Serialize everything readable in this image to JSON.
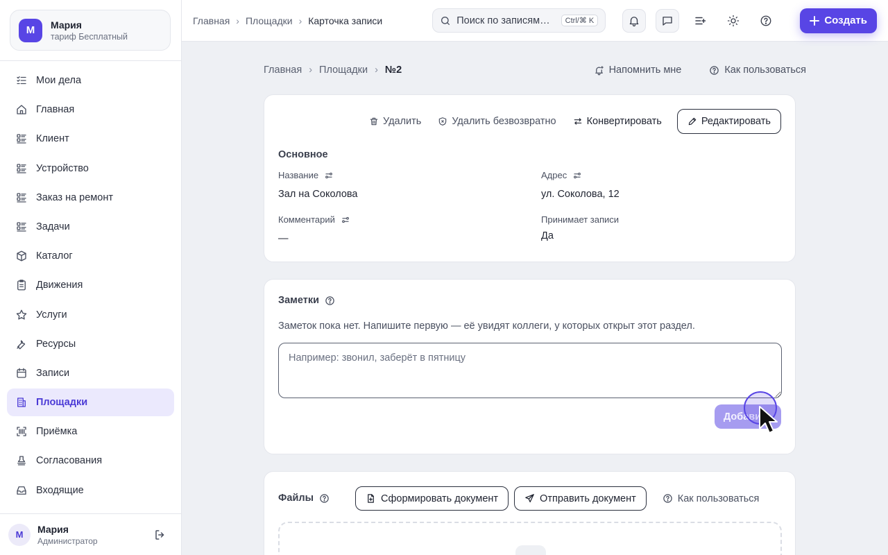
{
  "user": {
    "initial": "М",
    "name": "Мария",
    "plan": "тариф Бесплатный",
    "role": "Администратор"
  },
  "sidebar": {
    "items": [
      {
        "label": "Мои дела",
        "icon": "checklist-icon"
      },
      {
        "label": "Главная",
        "icon": "home-icon"
      },
      {
        "label": "Клиент",
        "icon": "list-icon"
      },
      {
        "label": "Устройство",
        "icon": "list-icon"
      },
      {
        "label": "Заказ на ремонт",
        "icon": "list-icon"
      },
      {
        "label": "Задачи",
        "icon": "list-icon"
      },
      {
        "label": "Каталог",
        "icon": "box-icon"
      },
      {
        "label": "Движения",
        "icon": "clipboard-icon"
      },
      {
        "label": "Услуги",
        "icon": "star-icon"
      },
      {
        "label": "Ресурсы",
        "icon": "wrench-icon"
      },
      {
        "label": "Записи",
        "icon": "calendar-icon"
      },
      {
        "label": "Площадки",
        "icon": "building-icon"
      },
      {
        "label": "Приёмка",
        "icon": "scan-icon"
      },
      {
        "label": "Согласования",
        "icon": "stamp-icon"
      },
      {
        "label": "Входящие",
        "icon": "inbox-icon"
      }
    ],
    "active_index": 11
  },
  "topbar": {
    "breadcrumbs": [
      "Главная",
      "Площадки",
      "Карточка записи"
    ],
    "search_placeholder": "Поиск по записям",
    "search_display": "Поиск по записям…",
    "shortcut": "Ctrl/⌘ K",
    "create_label": "Создать"
  },
  "page": {
    "breadcrumbs": [
      "Главная",
      "Площадки",
      "№2"
    ],
    "remind_label": "Напомнить мне",
    "howto_label": "Как пользоваться"
  },
  "record": {
    "actions": {
      "delete": "Удалить",
      "delete_forever": "Удалить безвозвратно",
      "convert": "Конвертировать",
      "edit": "Редактировать"
    },
    "section_title": "Основное",
    "fields": {
      "name": {
        "label": "Название",
        "value": "Зал на Соколова"
      },
      "address": {
        "label": "Адрес",
        "value": "ул. Соколова, 12"
      },
      "comment": {
        "label": "Комментарий",
        "value": "—"
      },
      "accepts": {
        "label": "Принимает записи",
        "value": "Да"
      }
    }
  },
  "notes": {
    "title": "Заметки",
    "empty_text": "Заметок пока нет. Напишите первую — её увидят коллеги, у которых открыт этот раздел.",
    "placeholder": "Например: звонил, заберёт в пятницу",
    "add_label": "Добавить"
  },
  "files": {
    "title": "Файлы",
    "generate_label": "Сформировать документ",
    "send_label": "Отправить документ",
    "howto_label": "Как пользоваться"
  },
  "colors": {
    "accent": "#5845e5",
    "active_bg": "#ebe9fd",
    "page_bg": "#eef0f4",
    "add_button_disabled": "#a69cf0"
  }
}
